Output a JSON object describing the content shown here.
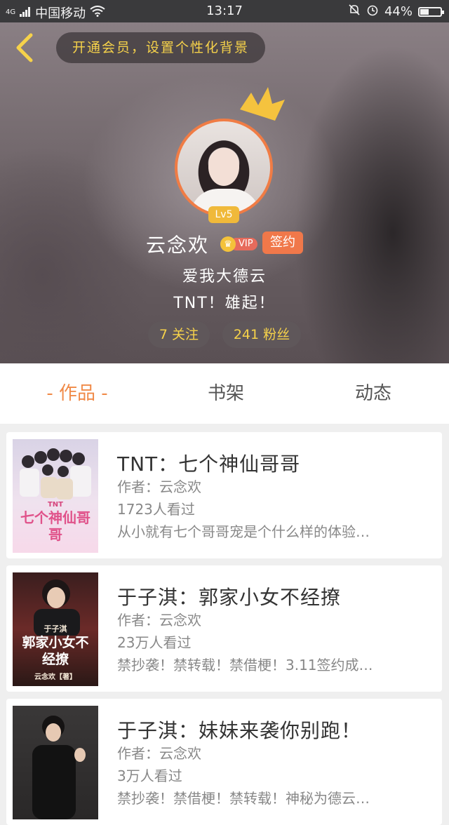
{
  "status_bar": {
    "network": "4G",
    "carrier": "中国移动",
    "time": "13:17",
    "battery": "44%",
    "battery_level": 0.44,
    "icons": [
      "signal-icon",
      "wifi-icon",
      "mute-bell-icon",
      "alarm-icon",
      "battery-icon"
    ]
  },
  "header": {
    "back_icon": "chevron-left-icon",
    "banner_text": "开通会员，设置个性化背景"
  },
  "profile": {
    "level": "Lv5",
    "name": "云念欢",
    "vip_label": "VIP",
    "signed_label": "签约",
    "bio_line1": "爱我大德云",
    "bio_line2": "TNT！雄起！",
    "following": "7 关注",
    "followers": "241 粉丝"
  },
  "tabs": [
    {
      "label": "- 作品 -",
      "active": true
    },
    {
      "label": "书架",
      "active": false
    },
    {
      "label": "动态",
      "active": false
    }
  ],
  "books": [
    {
      "title": "TNT：七个神仙哥哥",
      "author": "作者：云念欢",
      "views": "1723人看过",
      "desc": "从小就有七个哥哥宠是个什么样的体验…",
      "cover_title": "七个神仙哥哥",
      "cover_tag": "TNT"
    },
    {
      "title": "于子淇：郭家小女不经撩",
      "author": "作者：云念欢",
      "views": "23万人看过",
      "desc": "禁抄袭！禁转载！禁借梗！3.11签约成…",
      "cover_title": "郭家小女不经撩",
      "cover_tag": "于子淇",
      "cover_author": "云念欢【著】"
    },
    {
      "title": "于子淇：妹妹来袭你别跑！",
      "author": "作者：云念欢",
      "views": "3万人看过",
      "desc": "禁抄袭！禁借梗！禁转载！神秘为德云…"
    }
  ],
  "colors": {
    "accent": "#f08a48",
    "banner_text": "#f6d24a",
    "signed_badge": "#f0784a",
    "level_badge": "#f0b93a"
  }
}
